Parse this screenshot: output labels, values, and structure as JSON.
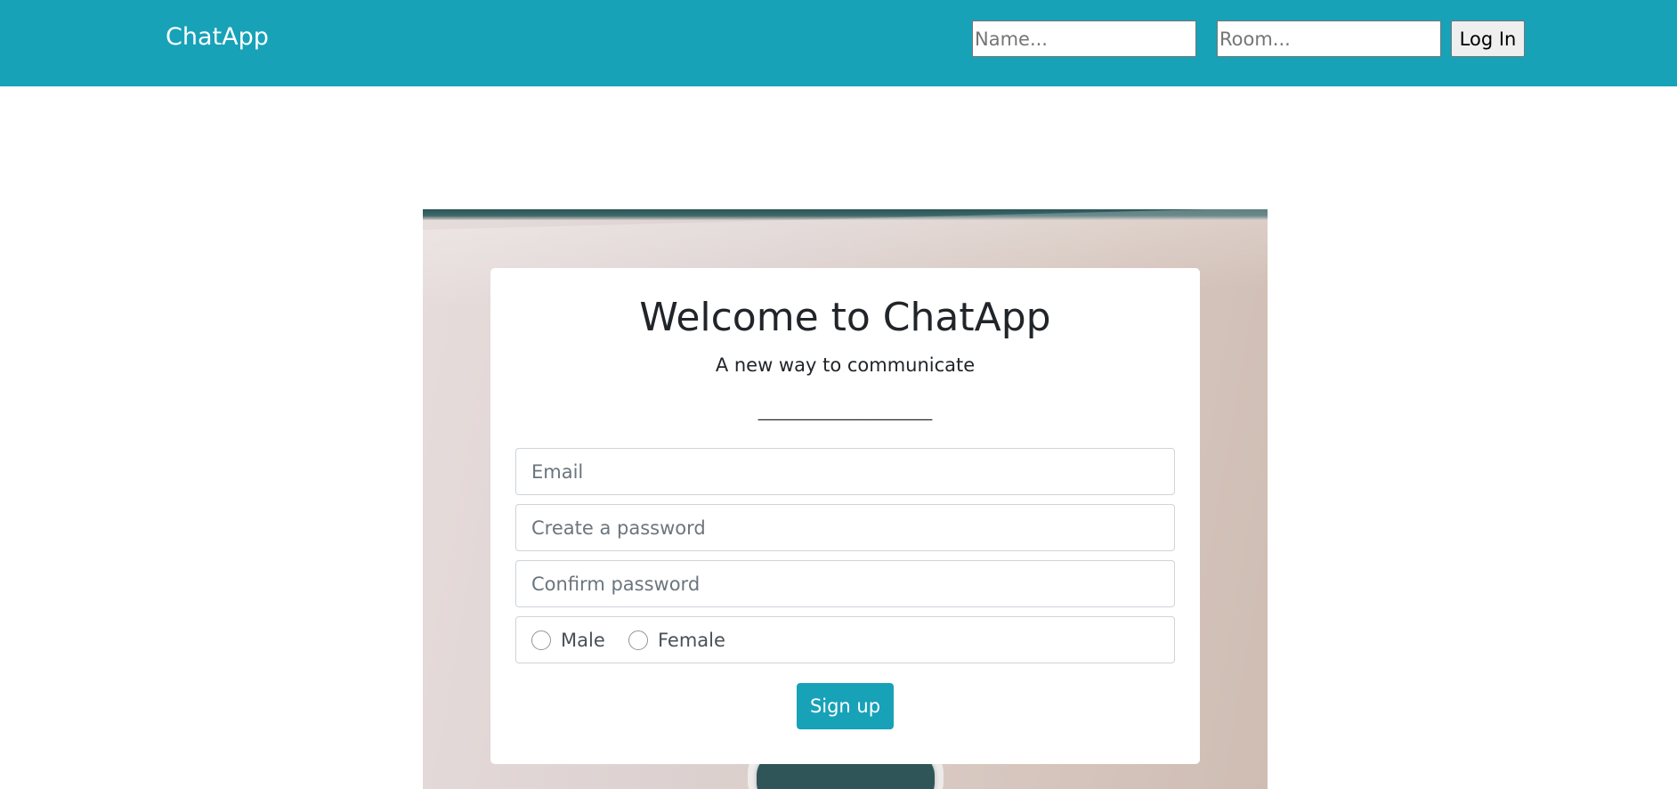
{
  "navbar": {
    "brand": "ChatApp",
    "name_placeholder": "Name...",
    "room_placeholder": "Room...",
    "login_label": "Log In"
  },
  "card": {
    "title": "Welcome to ChatApp",
    "subtitle": "A new way to communicate",
    "divider": "_______________________",
    "email_placeholder": "Email",
    "password_placeholder": "Create a password",
    "confirm_placeholder": "Confirm password",
    "gender_options": [
      "Male",
      "Female"
    ],
    "signup_label": "Sign up"
  },
  "colors": {
    "accent": "#17a2b8",
    "text": "#212529",
    "placeholder": "#6c757d",
    "field_border": "#ced4da"
  }
}
